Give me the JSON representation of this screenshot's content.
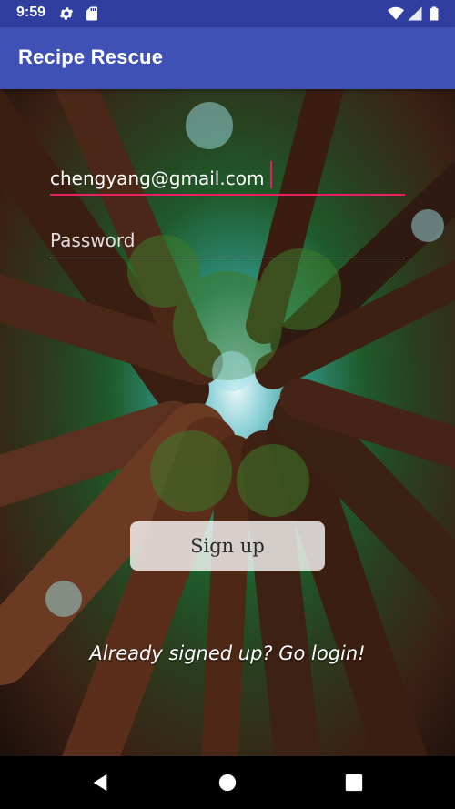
{
  "status_bar": {
    "time": "9:59",
    "icons": [
      "gear-icon",
      "sd-card-icon",
      "wifi-icon",
      "signal-icon",
      "battery-icon"
    ]
  },
  "app_bar": {
    "title": "Recipe Rescue",
    "color": "#3f51b5"
  },
  "form": {
    "email": {
      "value": "chengyang@gmail.com",
      "underline_color": "#e91e63"
    },
    "password": {
      "placeholder": "Password",
      "value": ""
    },
    "signup_button": "Sign up",
    "login_link": "Already signed up? Go login!"
  },
  "nav_bar": {
    "icons": [
      "back-icon",
      "home-icon",
      "recents-icon"
    ]
  }
}
